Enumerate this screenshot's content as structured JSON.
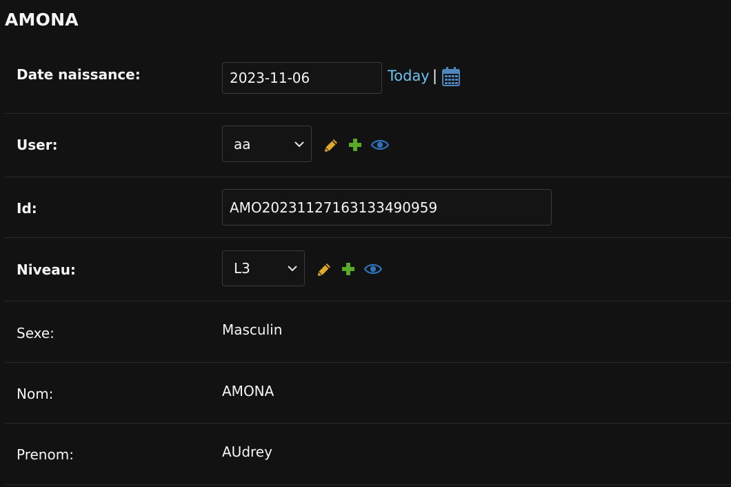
{
  "fieldset": {
    "title": "AMONA"
  },
  "fields": {
    "date_naissance": {
      "label": "Date naissance:",
      "value": "2023-11-06",
      "today_link": "Today",
      "separator": "|",
      "calendar_icon": "calendar-icon"
    },
    "user": {
      "label": "User:",
      "selected": "aa",
      "icons": [
        "pencil-icon",
        "plus-icon",
        "eye-icon"
      ]
    },
    "id": {
      "label": "Id:",
      "value": "AMO20231127163133490959"
    },
    "niveau": {
      "label": "Niveau:",
      "selected": "L3",
      "icons": [
        "pencil-icon",
        "plus-icon",
        "eye-icon"
      ]
    },
    "sexe": {
      "label": "Sexe:",
      "value": "Masculin"
    },
    "nom": {
      "label": "Nom:",
      "value": "AMONA"
    },
    "prenom": {
      "label": "Prenom:",
      "value": "AUdrey"
    }
  },
  "colors": {
    "background": "#121212",
    "link": "#6fc0ec",
    "change_icon": "#e0a92c",
    "add_icon": "#5aa928",
    "view_icon": "#2f72b9",
    "calendar_icon": "#4e86c0"
  }
}
